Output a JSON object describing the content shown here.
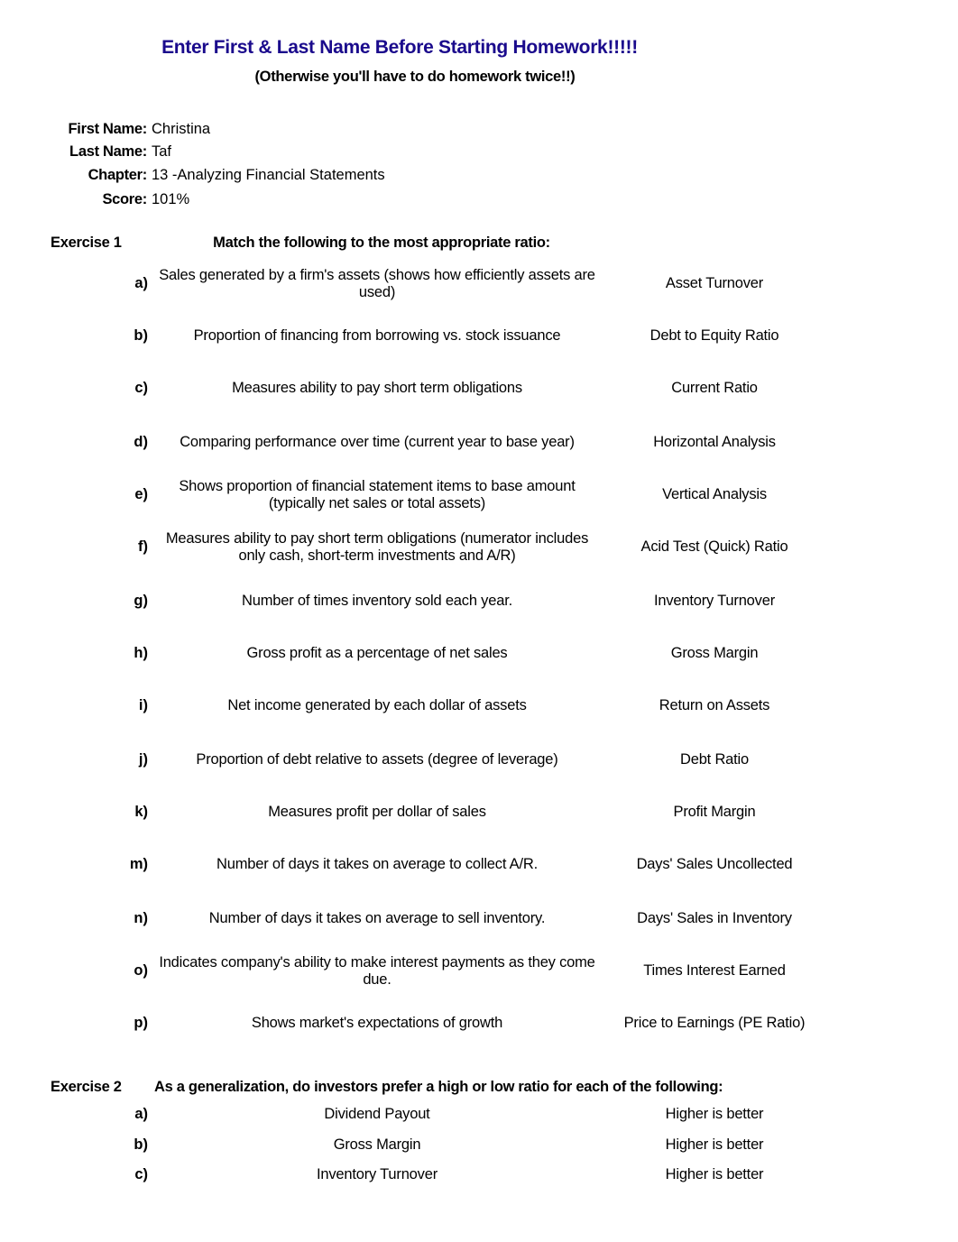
{
  "header": {
    "title": "Enter First & Last Name Before Starting Homework!!!!!",
    "subtitle": "(Otherwise you'll have to do homework twice!!)",
    "title_color": "#1a0a8c"
  },
  "info": {
    "first_name_label": "First Name:",
    "first_name": "Christina",
    "last_name_label": "Last Name:",
    "last_name": "Taf",
    "chapter_label": "Chapter:",
    "chapter": "13 -Analyzing Financial Statements",
    "score_label": "Score:",
    "score": "101%"
  },
  "exercise1": {
    "label": "Exercise 1",
    "instruction": "Match the following to the most appropriate ratio:",
    "items": [
      {
        "letter": "a)",
        "description": "Sales generated by a firm's assets (shows how efficiently assets are used)",
        "answer": "Asset Turnover"
      },
      {
        "letter": "b)",
        "description": "Proportion of financing from borrowing vs. stock issuance",
        "answer": "Debt to Equity Ratio"
      },
      {
        "letter": "c)",
        "description": "Measures ability to pay short term obligations",
        "answer": "Current Ratio"
      },
      {
        "letter": "d)",
        "description": "Comparing performance over time (current year to base year)",
        "answer": "Horizontal Analysis"
      },
      {
        "letter": "e)",
        "description": "Shows proportion of financial statement items to base amount (typically net sales or total assets)",
        "answer": "Vertical Analysis"
      },
      {
        "letter": "f)",
        "description": "Measures ability to pay short term obligations (numerator includes only cash, short-term investments and A/R)",
        "answer": "Acid Test (Quick) Ratio"
      },
      {
        "letter": "g)",
        "description": "Number of times inventory sold each year.",
        "answer": "Inventory Turnover"
      },
      {
        "letter": "h)",
        "description": "Gross profit as a percentage of net sales",
        "answer": "Gross Margin"
      },
      {
        "letter": "i)",
        "description": "Net income generated by each dollar of assets",
        "answer": "Return on Assets"
      },
      {
        "letter": "j)",
        "description": "Proportion of debt relative to assets (degree of leverage)",
        "answer": "Debt Ratio"
      },
      {
        "letter": "k)",
        "description": "Measures profit per dollar of sales",
        "answer": "Profit Margin"
      },
      {
        "letter": "m)",
        "description": "Number of days it takes on average to collect A/R.",
        "answer": "Days' Sales Uncollected"
      },
      {
        "letter": "n)",
        "description": "Number of days it takes on average to sell inventory.",
        "answer": "Days' Sales in Inventory"
      },
      {
        "letter": "o)",
        "description": "Indicates company's ability to make interest payments as they come due.",
        "answer": "Times Interest Earned"
      },
      {
        "letter": "p)",
        "description": "Shows market's expectations of growth",
        "answer": "Price to Earnings (PE Ratio)"
      }
    ]
  },
  "exercise2": {
    "label": "Exercise 2",
    "instruction": "As a generalization, do investors prefer a high or low ratio for each of the following:",
    "items": [
      {
        "letter": "a)",
        "description": "Dividend Payout",
        "answer": "Higher is better"
      },
      {
        "letter": "b)",
        "description": "Gross Margin",
        "answer": "Higher is better"
      },
      {
        "letter": "c)",
        "description": "Inventory Turnover",
        "answer": "Higher is better"
      }
    ]
  }
}
